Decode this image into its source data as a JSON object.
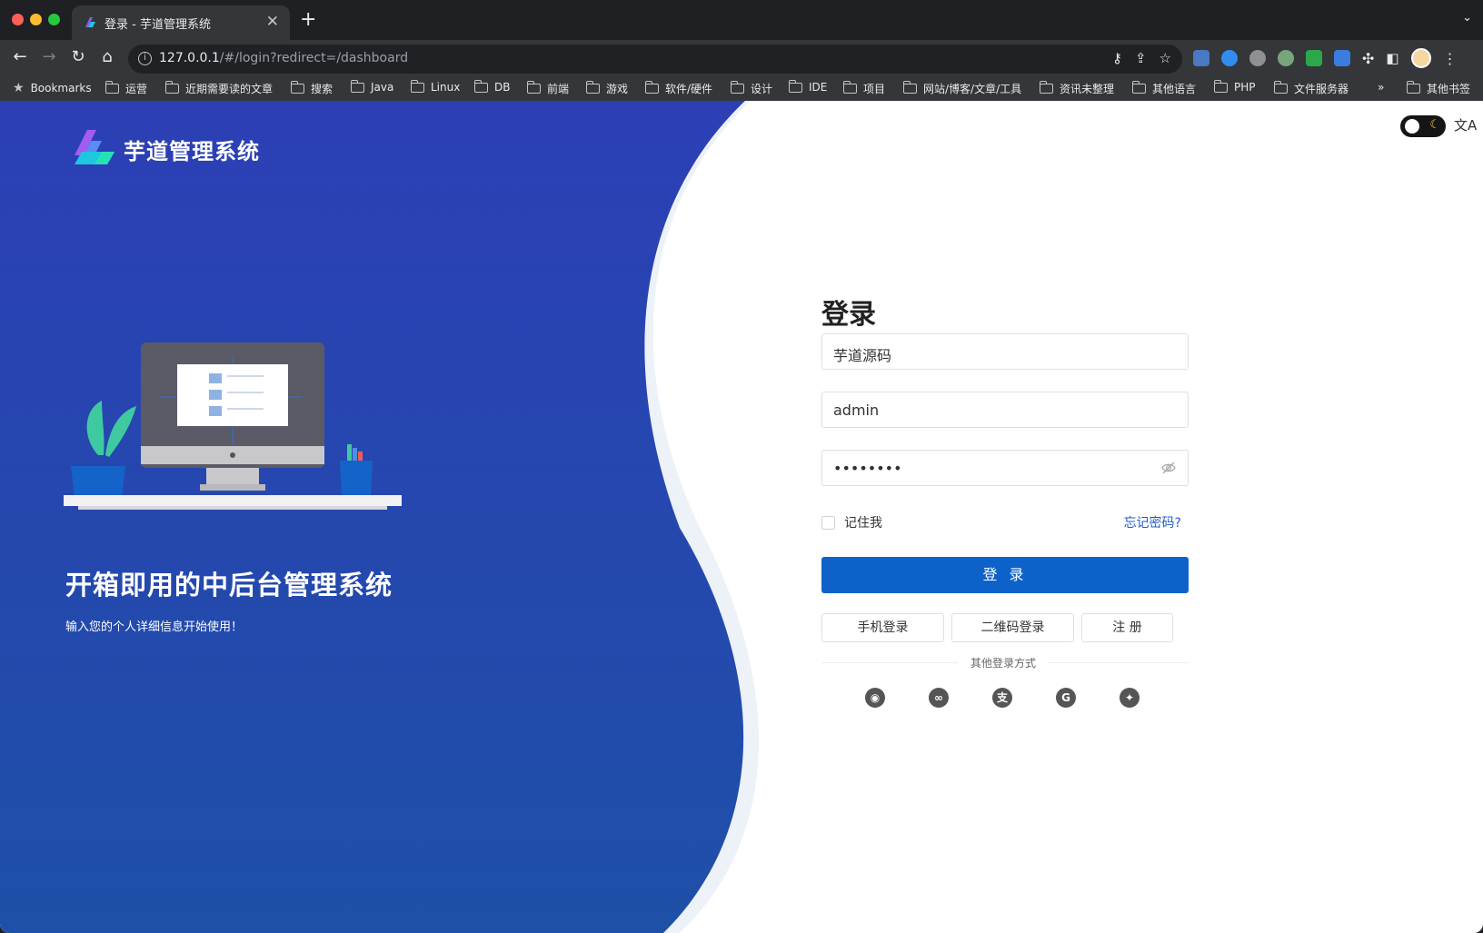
{
  "browser": {
    "tab_title": "登录 - 芋道管理系统",
    "tab_close": "✕",
    "new_tab": "+",
    "tabs_menu": "⌄",
    "url_host": "127.0.0.1",
    "url_path": "/#/login?redirect=/dashboard",
    "bookmarks_label": "Bookmarks",
    "bookmark_folders": [
      "运营",
      "近期需要读的文章",
      "搜索",
      "Java",
      "Linux",
      "DB",
      "前端",
      "游戏",
      "软件/硬件",
      "设计",
      "IDE",
      "项目",
      "网站/博客/文章/工具",
      "资讯未整理",
      "其他语言",
      "PHP",
      "文件服务器"
    ],
    "bookmarks_more": "»",
    "other_bookmarks": "其他书签",
    "icons": [
      "back-icon",
      "forward-icon",
      "reload-icon",
      "home-icon",
      "info-icon",
      "key-icon",
      "share-icon",
      "star-icon",
      "extensions-icon",
      "sidepanel-icon",
      "menu-icon"
    ]
  },
  "left": {
    "brand": "芋道管理系统",
    "headline": "开箱即用的中后台管理系统",
    "subline": "输入您的个人详细信息开始使用！",
    "colors": {
      "gradient_top": "#2c3fb5",
      "gradient_bottom": "#1e50a8"
    }
  },
  "form": {
    "title": "登录",
    "tenant_value": "芋道源码",
    "username_value": "admin",
    "password_value": "••••••••",
    "remember_label": "记住我",
    "forgot_label": "忘记密码?",
    "login_button": "登 录",
    "mobile_login": "手机登录",
    "qrcode_login": "二维码登录",
    "register": "注 册",
    "other_methods": "其他登录方式",
    "social_icons": [
      "github-icon",
      "wechat-icon",
      "alipay-icon",
      "google-icon",
      "twitter-icon"
    ],
    "colors": {
      "primary": "#0d62c9",
      "link": "#1f5dc7"
    }
  }
}
